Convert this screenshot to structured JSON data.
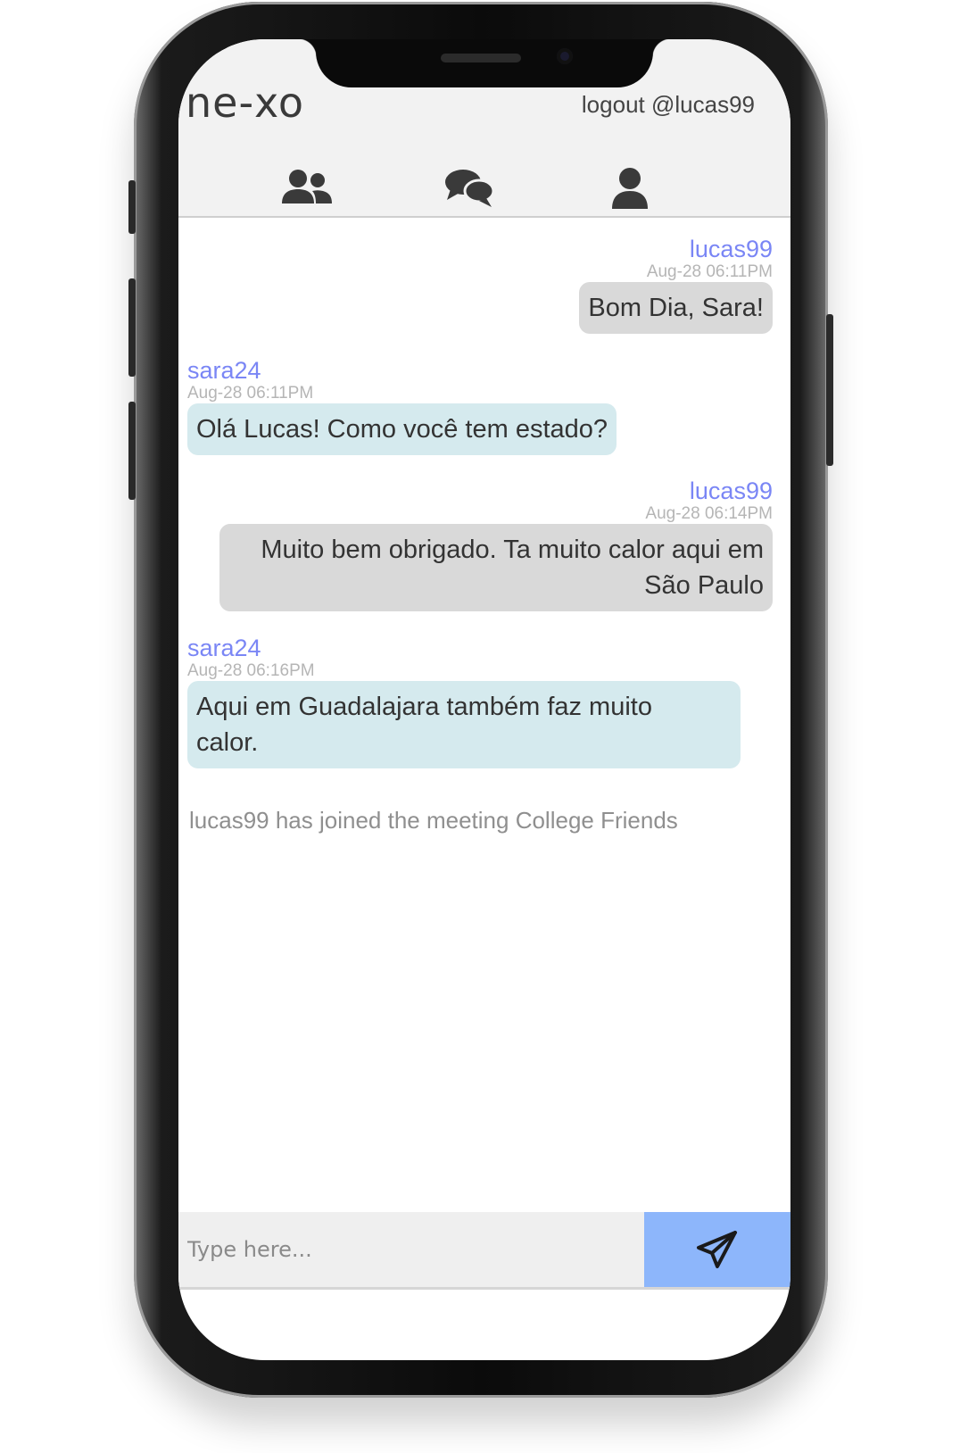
{
  "header": {
    "logo": "ne-xo",
    "logout_label": "logout",
    "username_label": "@lucas99"
  },
  "nav": {
    "icons": [
      "users-icon",
      "chat-bubbles-icon",
      "profile-icon"
    ]
  },
  "messages": [
    {
      "user": "lucas99",
      "time": "Aug-28 06:11PM",
      "text": "Bom Dia, Sara!",
      "side": "right"
    },
    {
      "user": "sara24",
      "time": "Aug-28 06:11PM",
      "text": "Olá Lucas! Como você tem estado?",
      "side": "left"
    },
    {
      "user": "lucas99",
      "time": "Aug-28 06:14PM",
      "text": "Muito bem obrigado. Ta muito calor aqui em São Paulo",
      "side": "right"
    },
    {
      "user": "sara24",
      "time": "Aug-28 06:16PM",
      "text": "Aqui em Guadalajara também faz muito calor.",
      "side": "left"
    }
  ],
  "system_message": "lucas99 has joined the meeting College Friends",
  "composer": {
    "placeholder": "Type here...",
    "send_icon": "paper-plane-icon"
  },
  "colors": {
    "header_bg": "#f2f2f2",
    "username_color": "#7a86f5",
    "own_bubble": "#d9d9d9",
    "other_bubble": "#d5eaee",
    "send_button": "#8db6fb"
  }
}
